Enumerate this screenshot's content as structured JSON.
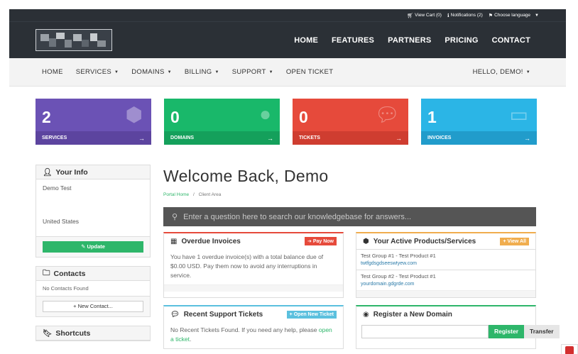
{
  "topbar": {
    "cart": "View Cart (0)",
    "notifications": "Notifications (2)",
    "language": "Choose language"
  },
  "mainnav": [
    "HOME",
    "FEATURES",
    "PARTNERS",
    "PRICING",
    "CONTACT"
  ],
  "subnav": {
    "items": [
      {
        "label": "HOME",
        "dropdown": false
      },
      {
        "label": "SERVICES",
        "dropdown": true
      },
      {
        "label": "DOMAINS",
        "dropdown": true
      },
      {
        "label": "BILLING",
        "dropdown": true
      },
      {
        "label": "SUPPORT",
        "dropdown": true
      },
      {
        "label": "OPEN TICKET",
        "dropdown": false
      }
    ],
    "user": "HELLO, DEMO!"
  },
  "tiles": [
    {
      "count": "2",
      "label": "SERVICES",
      "color": "#6b52b5",
      "footer_color": "#5c449f",
      "icon": "cube-icon"
    },
    {
      "count": "0",
      "label": "DOMAINS",
      "color": "#19b86a",
      "footer_color": "#14a05b",
      "icon": "globe-icon"
    },
    {
      "count": "0",
      "label": "TICKETS",
      "color": "#e64a3b",
      "footer_color": "#cf3d30",
      "icon": "comments-icon"
    },
    {
      "count": "1",
      "label": "INVOICES",
      "color": "#2bb5e6",
      "footer_color": "#219ccb",
      "icon": "credit-card-icon"
    }
  ],
  "sidebar": {
    "info_title": "Your Info",
    "info_name": "Demo Test",
    "info_country": "United States",
    "update_label": "Update",
    "contacts_title": "Contacts",
    "contacts_empty": "No Contacts Found",
    "new_contact_label": "New Contact...",
    "shortcuts_title": "Shortcuts"
  },
  "main": {
    "welcome": "Welcome Back, Demo",
    "breadcrumb_home": "Portal Home",
    "breadcrumb_sep": "/",
    "breadcrumb_current": "Client Area",
    "kb_placeholder": "Enter a question here to search our knowledgebase for answers..."
  },
  "invoices": {
    "title": "Overdue Invoices",
    "action": "Pay Now",
    "text": "You have 1 overdue invoice(s) with a total balance due of $0.00 USD. Pay them now to avoid any interruptions in service."
  },
  "products": {
    "title": "Your Active Products/Services",
    "action": "View All",
    "items": [
      {
        "name": "Test Group #1 - Test Product #1",
        "domain": "twtfgdsgdseeswtyew.com"
      },
      {
        "name": "Test Group #2 - Test Product #1",
        "domain": "yourdomain.gdgrde.com"
      }
    ]
  },
  "tickets": {
    "title": "Recent Support Tickets",
    "action": "Open New Ticket",
    "text": "No Recent Tickets Found. If you need any help, please",
    "link": "open a ticket"
  },
  "register": {
    "title": "Register a New Domain",
    "register_label": "Register",
    "transfer_label": "Transfer"
  }
}
